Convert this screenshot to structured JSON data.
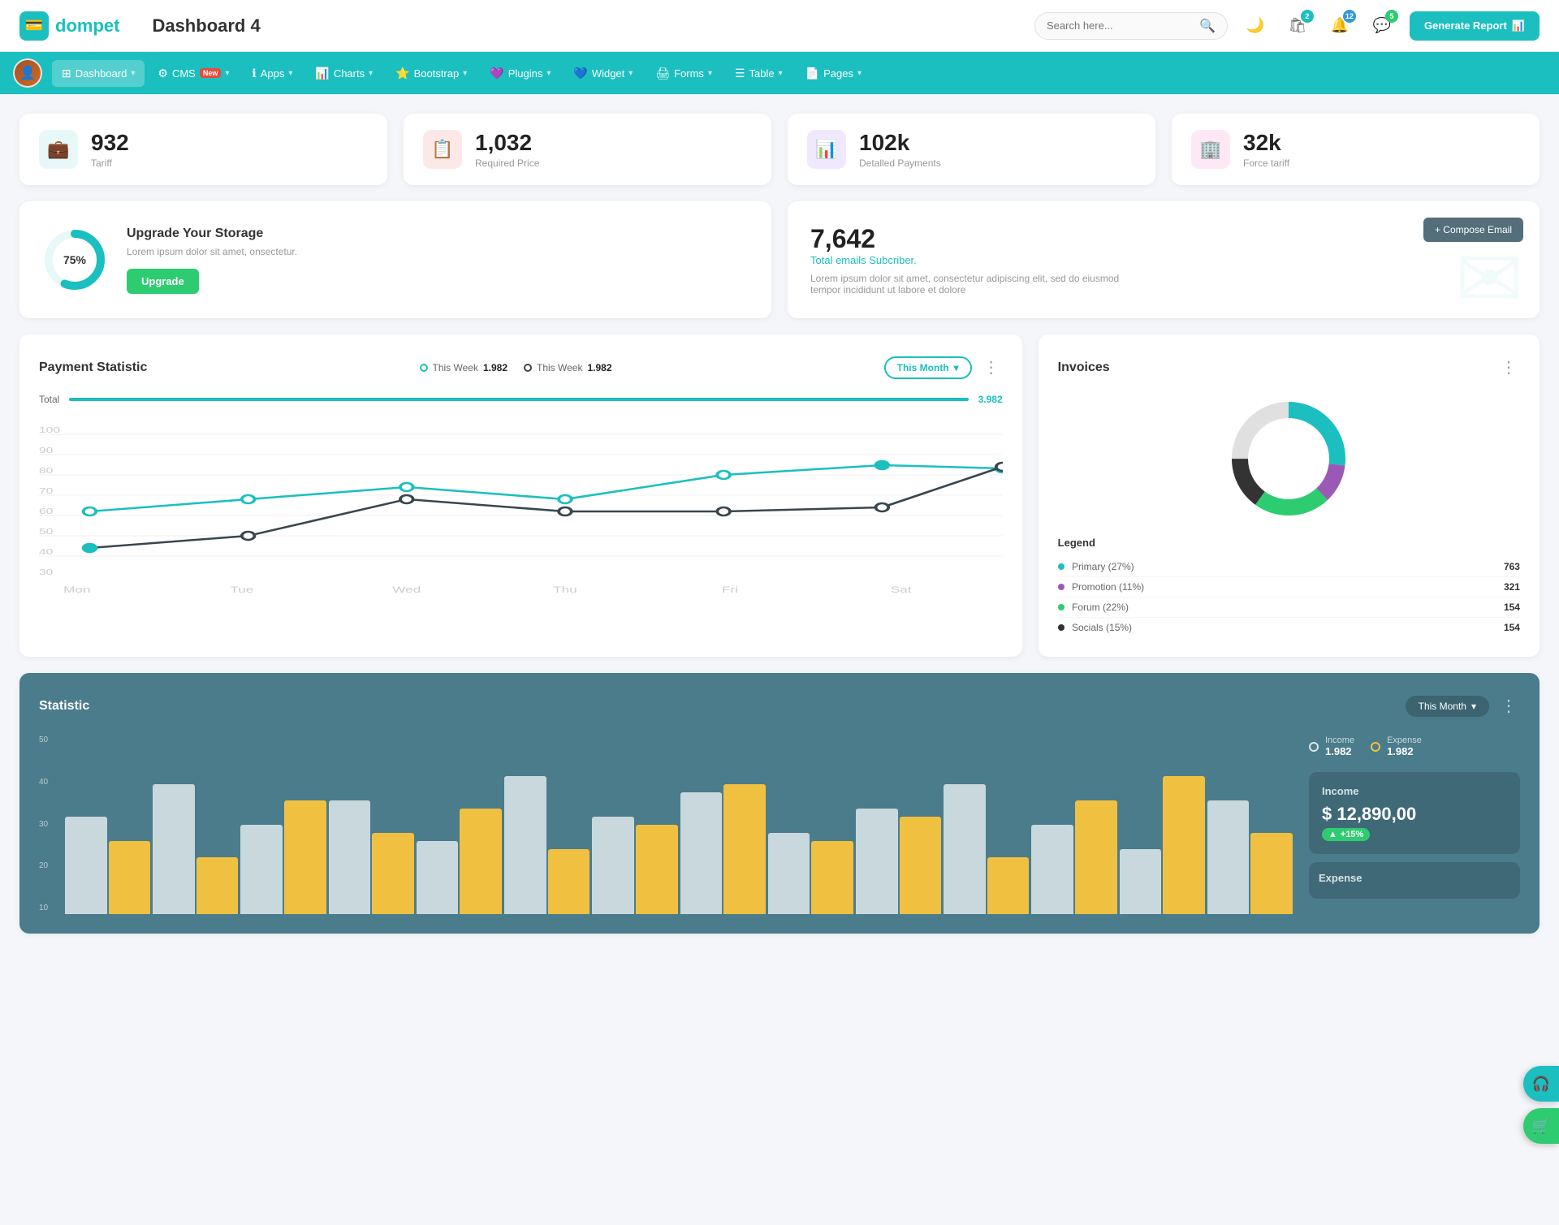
{
  "header": {
    "logo_icon": "💳",
    "logo_text": "dompet",
    "page_title": "Dashboard 4",
    "search_placeholder": "Search here...",
    "generate_btn": "Generate Report",
    "icons": {
      "moon": "🌙",
      "gift": "🛍",
      "bell": "🔔",
      "chat": "💬"
    },
    "badges": {
      "gift": "2",
      "bell": "12",
      "chat": "5"
    }
  },
  "navbar": {
    "items": [
      {
        "label": "Dashboard",
        "icon": "⊞",
        "active": true
      },
      {
        "label": "CMS",
        "icon": "⚙",
        "badge": "New"
      },
      {
        "label": "Apps",
        "icon": "ℹ"
      },
      {
        "label": "Charts",
        "icon": "📊"
      },
      {
        "label": "Bootstrap",
        "icon": "⭐"
      },
      {
        "label": "Plugins",
        "icon": "💜"
      },
      {
        "label": "Widget",
        "icon": "💙"
      },
      {
        "label": "Forms",
        "icon": "🖨"
      },
      {
        "label": "Table",
        "icon": "☰"
      },
      {
        "label": "Pages",
        "icon": "📄"
      }
    ]
  },
  "stat_cards": [
    {
      "value": "932",
      "label": "Tariff",
      "icon": "💼",
      "icon_class": "teal"
    },
    {
      "value": "1,032",
      "label": "Required Price",
      "icon": "📋",
      "icon_class": "red"
    },
    {
      "value": "102k",
      "label": "Detalled Payments",
      "icon": "📊",
      "icon_class": "purple"
    },
    {
      "value": "32k",
      "label": "Force tariff",
      "icon": "🏢",
      "icon_class": "pink"
    }
  ],
  "storage": {
    "percentage": "75%",
    "title": "Upgrade Your Storage",
    "description": "Lorem ipsum dolor sit amet, onsectetur.",
    "button": "Upgrade",
    "donut_value": 75
  },
  "email_card": {
    "number": "7,642",
    "subtitle": "Total emails Subcriber.",
    "description": "Lorem ipsum dolor sit amet, consectetur adipiscing elit, sed do eiusmod tempor incididunt ut labore et dolore",
    "compose_btn": "+ Compose Email"
  },
  "payment_chart": {
    "title": "Payment Statistic",
    "filter": "This Month",
    "legend1_label": "This Week",
    "legend1_value": "1.982",
    "legend2_label": "This Week",
    "legend2_value": "1.982",
    "total_label": "Total",
    "total_value": "3.982",
    "y_axis": [
      "100",
      "90",
      "80",
      "70",
      "60",
      "50",
      "40",
      "30"
    ],
    "x_axis": [
      "Mon",
      "Tue",
      "Wed",
      "Thu",
      "Fri",
      "Sat"
    ],
    "line1_points": "30,180 130,150 230,120 330,145 430,110 530,80",
    "line2_points": "30,160 130,165 230,175 330,160 430,120 530,115"
  },
  "invoices": {
    "title": "Invoices",
    "legend": [
      {
        "label": "Primary (27%)",
        "color": "#1bbfbf",
        "value": "763"
      },
      {
        "label": "Promotion (11%)",
        "color": "#9b59b6",
        "value": "321"
      },
      {
        "label": "Forum (22%)",
        "color": "#2ecc71",
        "value": "154"
      },
      {
        "label": "Socials (15%)",
        "color": "#333",
        "value": "154"
      }
    ]
  },
  "statistic": {
    "title": "Statistic",
    "filter": "This Month",
    "income_label": "Income",
    "income_value": "1.982",
    "expense_label": "Expense",
    "expense_value": "1.982",
    "income_panel_title": "Income",
    "income_amount": "$ 12,890,00",
    "income_badge": "+15%",
    "y_labels": [
      "50",
      "40",
      "30",
      "20",
      "10"
    ],
    "bar_groups": [
      {
        "white": 60,
        "yellow": 45
      },
      {
        "white": 80,
        "yellow": 35
      },
      {
        "white": 55,
        "yellow": 70
      },
      {
        "white": 70,
        "yellow": 50
      },
      {
        "white": 45,
        "yellow": 65
      },
      {
        "white": 85,
        "yellow": 40
      },
      {
        "white": 60,
        "yellow": 55
      },
      {
        "white": 75,
        "yellow": 80
      },
      {
        "white": 50,
        "yellow": 45
      },
      {
        "white": 65,
        "yellow": 60
      },
      {
        "white": 80,
        "yellow": 35
      },
      {
        "white": 55,
        "yellow": 70
      },
      {
        "white": 40,
        "yellow": 85
      },
      {
        "white": 70,
        "yellow": 50
      }
    ]
  },
  "float_buttons": {
    "headset": "🎧",
    "cart": "🛒"
  }
}
